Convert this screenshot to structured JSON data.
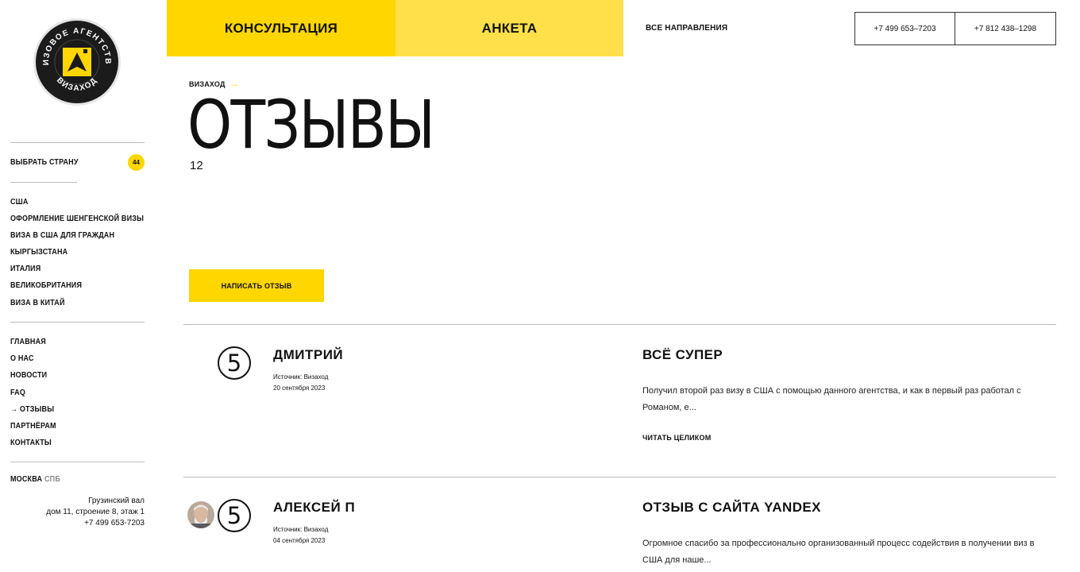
{
  "logo": {
    "ring_text_top": "ВИЗОВОЕ АГЕНТСТВО",
    "ring_text_bottom": "ВИЗАХОД"
  },
  "sidebar": {
    "choose_country": "ВЫБРАТЬ СТРАНУ",
    "country_count": "44",
    "countries": [
      "США",
      "ОФОРМЛЕНИЕ ШЕНГЕНСКОЙ ВИЗЫ",
      "ВИЗА В США ДЛЯ ГРАЖДАН",
      "КЫРГЫЗСТАНА",
      "ИТАЛИЯ",
      "ВЕЛИКОБРИТАНИЯ",
      "ВИЗА В КИТАЙ"
    ],
    "nav": [
      "ГЛАВНАЯ",
      "О НАС",
      "НОВОСТИ",
      "FAQ",
      "→ ОТЗЫВЫ",
      "ПАРТНЁРАМ",
      "КОНТАКТЫ"
    ],
    "city_moscow": "МОСКВА",
    "city_spb": "СПБ",
    "address_line1": "Грузинский вал",
    "address_line2": "дом 11, строение 8, этаж 1",
    "address_phone": "+7 499 653-7203"
  },
  "header": {
    "tab_consult": "КОНСУЛЬТАЦИЯ",
    "tab_form": "АНКЕТА",
    "all_directions": "ВСЕ НАПРАВЛЕНИЯ",
    "phone_1": "+7 499 653–7203",
    "phone_2": "+7 812 438–1298"
  },
  "main": {
    "breadcrumb": "ВИЗАХОД",
    "breadcrumb_arrow": "→",
    "title": "ОТЗЫВЫ",
    "count": "12",
    "write_review": "НАПИСАТЬ ОТЗЫВ"
  },
  "reviews": [
    {
      "rating": "5",
      "name": "ДМИТРИЙ",
      "source": "Источник: Визаход",
      "date": "20 сентября 2023",
      "title": "ВСЁ СУПЕР",
      "text": "Получил второй раз визу в США с помощью данного агентства, и как в первый раз работал с Романом, е...",
      "read_more": "ЧИТАТЬ ЦЕЛИКОМ"
    },
    {
      "rating": "5",
      "name": "АЛЕКСЕЙ П",
      "source": "Источник: Визаход",
      "date": "04 сентября 2023",
      "title": "ОТЗЫВ С САЙТА YANDEX",
      "text": "Огромное спасибо за профессионально организованный процесс содействия в получении виз в США для наше..."
    }
  ],
  "colors": {
    "accent_yellow": "#ffd600",
    "accent_yellow_light": "#ffe04a",
    "text": "#111111",
    "divider": "#bbbbbb"
  }
}
